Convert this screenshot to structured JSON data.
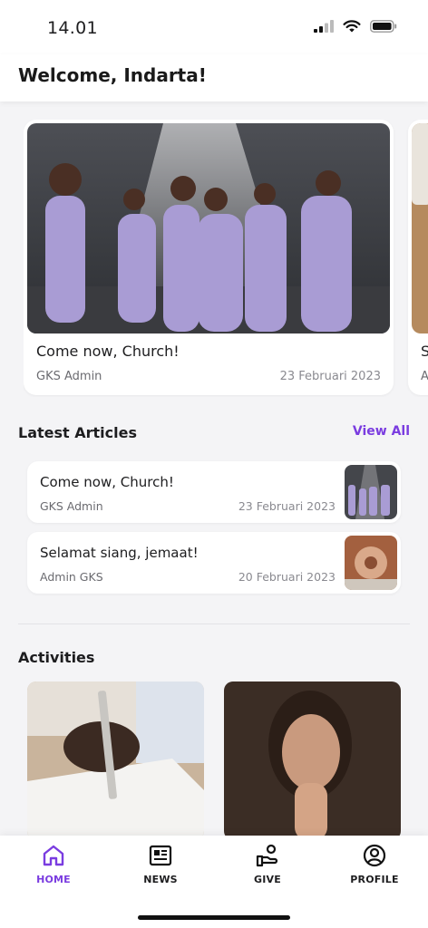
{
  "status_bar": {
    "time": "14.01"
  },
  "header": {
    "title": "Welcome, Indarta!"
  },
  "featured": [
    {
      "title": "Come now, Church!",
      "author": "GKS Admin",
      "date": "23 Februari 2023"
    },
    {
      "title": "S",
      "author": "A"
    }
  ],
  "latest_articles": {
    "heading": "Latest Articles",
    "view_all": "View All",
    "items": [
      {
        "title": "Come now, Church!",
        "author": "GKS Admin",
        "date": "23 Februari 2023"
      },
      {
        "title": "Selamat siang, jemaat!",
        "author": "Admin GKS",
        "date": "20 Februari 2023"
      }
    ]
  },
  "activities": {
    "heading": "Activities"
  },
  "tabs": [
    {
      "label": "HOME",
      "icon": "home-icon",
      "active": true
    },
    {
      "label": "NEWS",
      "icon": "newspaper-icon"
    },
    {
      "label": "GIVE",
      "icon": "give-hand-icon"
    },
    {
      "label": "PROFILE",
      "icon": "user-icon"
    }
  ],
  "colors": {
    "accent": "#7a3ce0",
    "background": "#f4f4f6",
    "card": "#ffffff"
  }
}
